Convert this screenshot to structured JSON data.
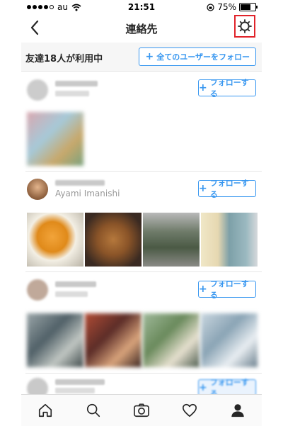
{
  "status_bar": {
    "carrier": "au",
    "time": "21:51",
    "battery": "75%",
    "battery_level": 0.75,
    "signal_bars": 4
  },
  "header": {
    "title": "連絡先",
    "back_icon": "chevron-left-icon",
    "settings_icon": "gear-icon"
  },
  "banner": {
    "text": "友達18人が利用中",
    "follow_all_label": "全てのユーザーをフォロー"
  },
  "contacts": [
    {
      "real_name": "",
      "follow_label": "フォローする",
      "photos_count": 1
    },
    {
      "real_name": "Ayami Imanishi",
      "follow_label": "フォローする",
      "photos_count": 4
    },
    {
      "real_name": "",
      "follow_label": "フォローする",
      "photos_count": 4
    },
    {
      "real_name": "",
      "follow_label": "フォローする",
      "photos_count": 0
    }
  ],
  "tabs": [
    {
      "name": "home-icon"
    },
    {
      "name": "search-icon"
    },
    {
      "name": "camera-icon"
    },
    {
      "name": "heart-icon"
    },
    {
      "name": "profile-icon"
    }
  ],
  "colors": {
    "accent": "#3897f0",
    "highlight_box": "#e0232a",
    "banner_bg": "#f6f6f6"
  }
}
